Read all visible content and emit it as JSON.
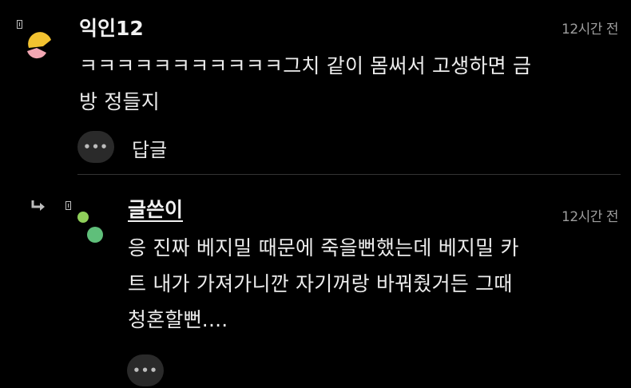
{
  "comments": [
    {
      "author": "익인12",
      "time": "12시간 전",
      "lines": [
        "ㅋㅋㅋㅋㅋㅋㅋㅋㅋㅋㅋ그치 같이 몸써서 고생하면 금",
        "방 정들지"
      ],
      "reply_label": "답글",
      "more_label": "•••"
    },
    {
      "author": "글쓴이",
      "time": "12시간 전",
      "lines": [
        "응 진짜 베지밀 때문에 죽을뻔했는데 베지밀 카",
        "트 내가 가져가니깐 자기꺼랑 바꿔줬거든 그때",
        "청혼할뻔...."
      ],
      "more_label": "•••"
    }
  ],
  "colors": {
    "background": "#000000",
    "avatar1_yellow": "#f2c230",
    "avatar1_pink": "#f2a7b3",
    "avatar2_green_light": "#8fcf5a",
    "avatar2_green": "#5fbf7a"
  }
}
